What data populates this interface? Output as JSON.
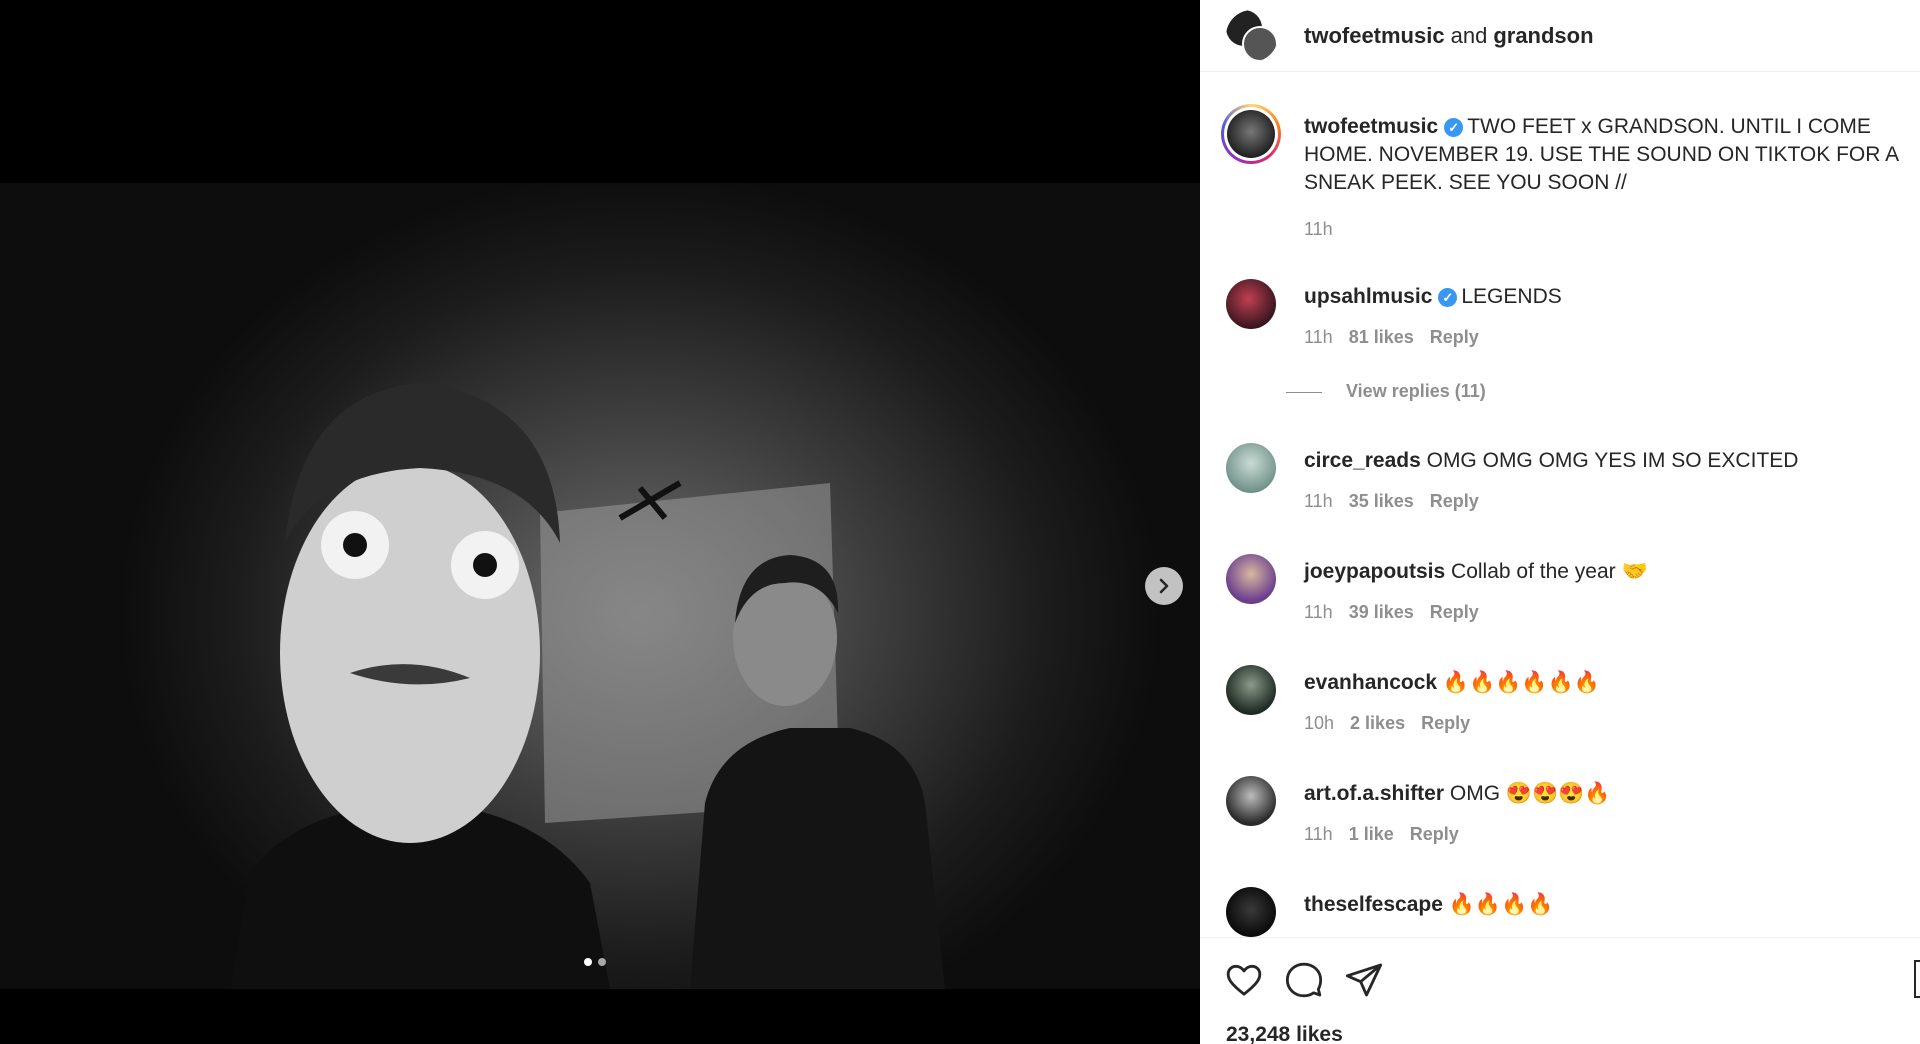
{
  "media": {
    "next_icon": "chevron-right-icon",
    "carousel": {
      "count": 2,
      "active_index": 0
    }
  },
  "header": {
    "user1": "twofeetmusic",
    "and_text": "and",
    "user2": "grandson"
  },
  "caption": {
    "username": "twofeetmusic",
    "verified": true,
    "text": "TWO FEET x GRANDSON. UNTIL I COME HOME. NOVEMBER 19. USE THE SOUND ON TIKTOK FOR A SNEAK PEEK. SEE YOU SOON //",
    "time": "11h"
  },
  "comments": [
    {
      "username": "upsahlmusic",
      "verified": true,
      "text": "LEGENDS",
      "time": "11h",
      "likes": "81 likes",
      "reply": "Reply",
      "view_replies": "View replies (11)",
      "avatar_color": "#6b2030"
    },
    {
      "username": "circe_reads",
      "verified": false,
      "text": "OMG OMG OMG YES IM SO EXCITED",
      "time": "11h",
      "likes": "35 likes",
      "reply": "Reply",
      "avatar_color": "#8fa9a0"
    },
    {
      "username": "joeypapoutsis",
      "verified": false,
      "text": "Collab of the year 🤝",
      "time": "11h",
      "likes": "39 likes",
      "reply": "Reply",
      "avatar_color": "#6a3d8e"
    },
    {
      "username": "evanhancock",
      "verified": false,
      "text": "🔥🔥🔥🔥🔥🔥",
      "time": "10h",
      "likes": "2 likes",
      "reply": "Reply",
      "avatar_color": "#2d3a2f"
    },
    {
      "username": "art.of.a.shifter",
      "verified": false,
      "text": "OMG 😍😍😍🔥",
      "time": "11h",
      "likes": "1 like",
      "reply": "Reply",
      "avatar_color": "#3a3a3a"
    },
    {
      "username": "theselfescape",
      "verified": false,
      "text": "🔥🔥🔥🔥",
      "avatar_color": "#111111"
    }
  ],
  "actions": {
    "like_icon": "heart-icon",
    "comment_icon": "comment-icon",
    "share_icon": "paper-plane-icon",
    "save_icon": "bookmark-icon",
    "likes_count": "23,248 likes"
  },
  "colors": {
    "verified": "#3897f0",
    "muted": "#8e8e8e",
    "text": "#262626"
  }
}
